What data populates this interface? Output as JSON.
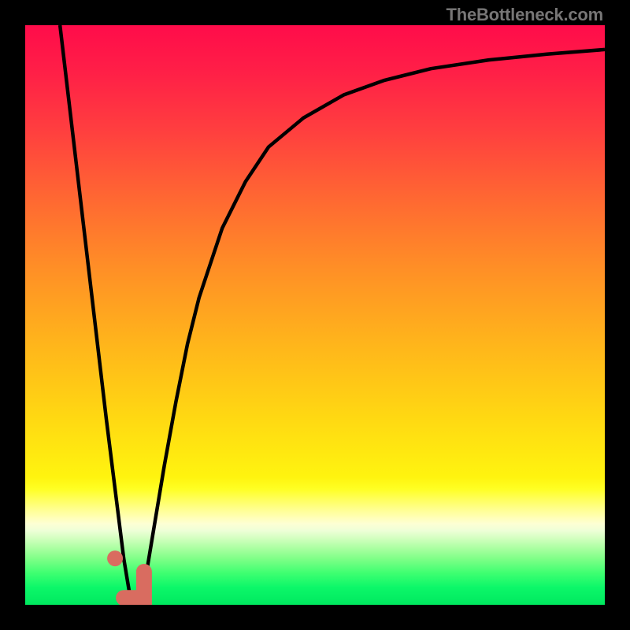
{
  "watermark": {
    "text": "TheBottleneck.com"
  },
  "colors": {
    "bg_frame": "#000000",
    "marker_fill": "#d96c60",
    "curve_stroke": "#000000",
    "gradient_stops": [
      {
        "offset": 0.0,
        "color": "#ff0c4a"
      },
      {
        "offset": 0.08,
        "color": "#ff1f47"
      },
      {
        "offset": 0.18,
        "color": "#ff3e3f"
      },
      {
        "offset": 0.3,
        "color": "#ff6832"
      },
      {
        "offset": 0.42,
        "color": "#ff8f26"
      },
      {
        "offset": 0.55,
        "color": "#ffb51b"
      },
      {
        "offset": 0.68,
        "color": "#ffd912"
      },
      {
        "offset": 0.78,
        "color": "#fff40f"
      },
      {
        "offset": 0.8,
        "color": "#ffff23"
      },
      {
        "offset": 0.82,
        "color": "#ffff62"
      },
      {
        "offset": 0.835,
        "color": "#ffff8f"
      },
      {
        "offset": 0.85,
        "color": "#ffffb8"
      },
      {
        "offset": 0.86,
        "color": "#fdffd4"
      },
      {
        "offset": 0.872,
        "color": "#eeffd7"
      },
      {
        "offset": 0.885,
        "color": "#d3ffc0"
      },
      {
        "offset": 0.9,
        "color": "#b0ffa5"
      },
      {
        "offset": 0.92,
        "color": "#80ff88"
      },
      {
        "offset": 0.945,
        "color": "#3fff71"
      },
      {
        "offset": 0.97,
        "color": "#0cf769"
      },
      {
        "offset": 1.0,
        "color": "#00e85f"
      }
    ]
  },
  "chart_data": {
    "type": "line",
    "title": "",
    "xlabel": "",
    "ylabel": "",
    "xlim": [
      0,
      100
    ],
    "ylim": [
      0,
      100
    ],
    "series": [
      {
        "name": "bottleneck-curve",
        "x": [
          6,
          8,
          10,
          12,
          14,
          16,
          17,
          18,
          19,
          20,
          21,
          22,
          24,
          26,
          28,
          30,
          34,
          38,
          42,
          48,
          55,
          62,
          70,
          80,
          90,
          100
        ],
        "y": [
          100,
          83,
          66,
          49,
          32,
          16,
          8,
          2,
          0.5,
          2,
          6,
          12,
          24,
          35,
          45,
          53,
          65,
          73,
          79,
          84,
          88,
          90.5,
          92.5,
          94,
          95,
          95.8
        ]
      }
    ],
    "marker": {
      "x": 15.5,
      "y": 8
    },
    "optimal_segment": {
      "x0": 17,
      "y0": 1.2,
      "x1": 20.5,
      "y1": 1.2,
      "cap": 4.5
    }
  }
}
